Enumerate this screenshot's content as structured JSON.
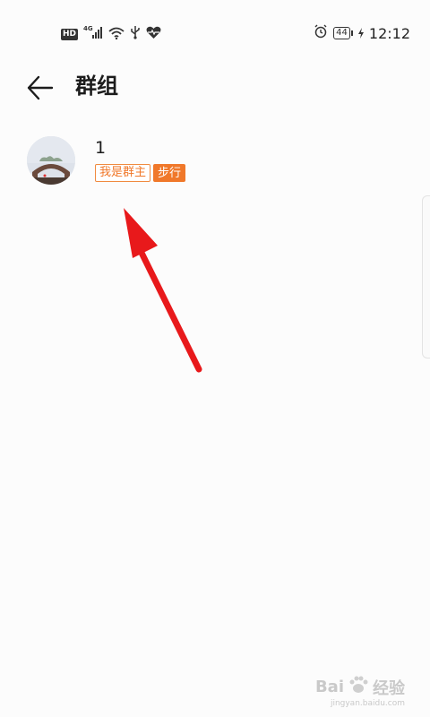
{
  "status_bar": {
    "hd_badge": "HD",
    "network_label": "4G",
    "icons": [
      "signal-icon",
      "wifi-icon",
      "usb-icon",
      "health-icon",
      "alarm-icon",
      "charging-icon"
    ],
    "battery_level": "44",
    "time": "12:12"
  },
  "header": {
    "title": "群组"
  },
  "groups": [
    {
      "name": "1",
      "tags": [
        "我是群主",
        "步行"
      ]
    }
  ],
  "watermark": {
    "text": "Bai",
    "text2": "经验",
    "sub": "jingyan.baidu.com"
  },
  "colors": {
    "accent": "#f0782a",
    "annotation_arrow": "#e8191b"
  }
}
